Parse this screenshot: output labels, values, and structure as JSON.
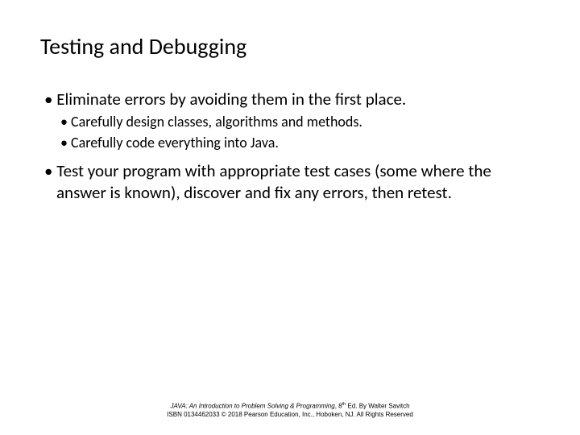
{
  "slide": {
    "title": "Testing and Debugging",
    "bullets": [
      {
        "text": "Eliminate errors by avoiding them in the first place.",
        "sub": [
          "Carefully design classes, algorithms and methods.",
          "Carefully code everything into Java."
        ]
      },
      {
        "text": "Test your program with appropriate test cases (some where the answer is known), discover and fix any errors, then retest.",
        "sub": []
      }
    ],
    "footer": {
      "book_title": "JAVA: An Introduction to Problem Solving & Programming",
      "edition": ", 8",
      "edition_suffix": "th",
      "byline": " Ed. By Walter Savitch",
      "line2": "ISBN 0134462033 © 2018 Pearson Education, Inc., Hoboken, NJ. All Rights Reserved"
    }
  }
}
